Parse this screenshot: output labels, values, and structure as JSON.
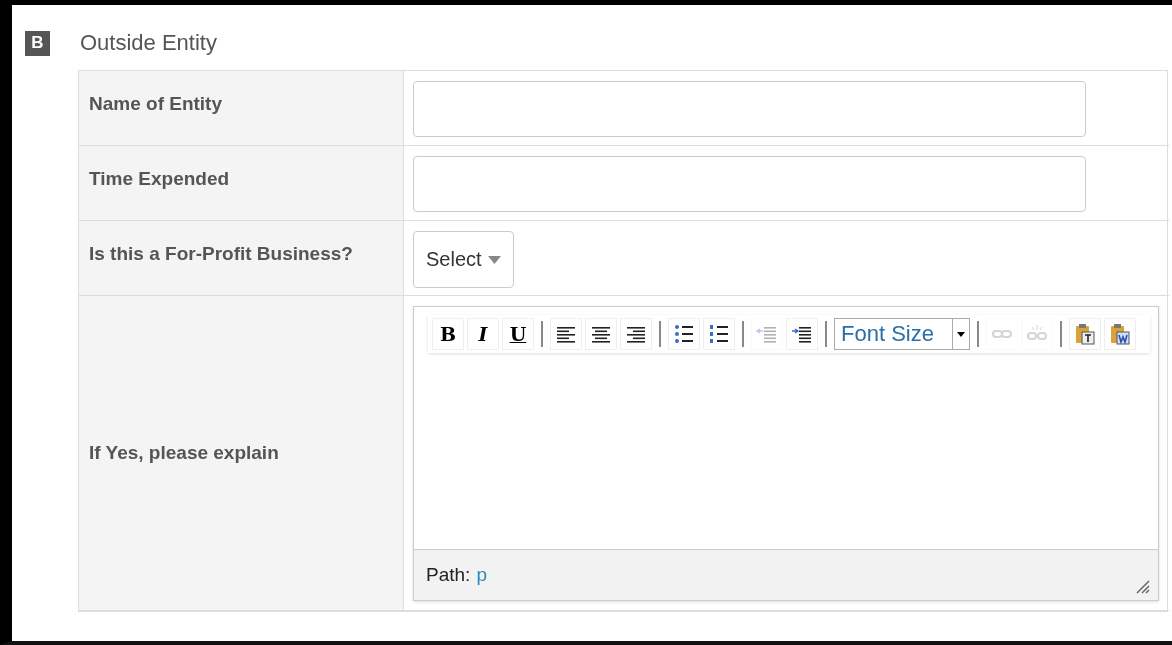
{
  "section": {
    "badge": "B",
    "title": "Outside Entity"
  },
  "fields": [
    {
      "kind": "text",
      "label": "Name of Entity"
    },
    {
      "kind": "text",
      "label": "Time Expended"
    },
    {
      "kind": "select",
      "label": "Is this a For-Profit Business?",
      "value": "Select"
    },
    {
      "kind": "editor",
      "label": "If Yes, please explain"
    }
  ],
  "editor": {
    "toolbar": [
      {
        "kind": "bold",
        "label": "B",
        "disabled": false
      },
      {
        "kind": "italic",
        "label": "I",
        "disabled": false
      },
      {
        "kind": "underline",
        "label": "U",
        "disabled": false
      },
      {
        "kind": "separator"
      },
      {
        "kind": "align-left",
        "disabled": false
      },
      {
        "kind": "align-center",
        "disabled": false
      },
      {
        "kind": "align-right",
        "disabled": false
      },
      {
        "kind": "separator"
      },
      {
        "kind": "bullets",
        "disabled": false
      },
      {
        "kind": "numbers",
        "disabled": false
      },
      {
        "kind": "separator"
      },
      {
        "kind": "outdent",
        "disabled": true
      },
      {
        "kind": "indent",
        "disabled": false
      },
      {
        "kind": "separator"
      },
      {
        "kind": "font-size",
        "label": "Font Size",
        "disabled": false
      },
      {
        "kind": "separator"
      },
      {
        "kind": "link",
        "disabled": true
      },
      {
        "kind": "unlink",
        "disabled": true
      },
      {
        "kind": "separator"
      },
      {
        "kind": "paste-text",
        "disabled": false
      },
      {
        "kind": "paste-word",
        "disabled": false
      }
    ],
    "path_label": "Path:",
    "path_value": "p"
  }
}
